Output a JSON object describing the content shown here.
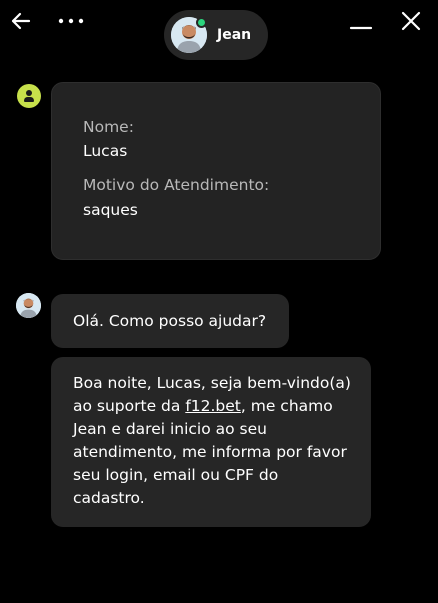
{
  "header": {
    "agent_name": "Jean",
    "icons": {
      "back": "arrow-left-icon",
      "more": "more-horizontal-icon",
      "minimize": "minimize-icon",
      "close": "close-icon"
    },
    "status_color": "#2bd47e"
  },
  "info_card": {
    "name_label": "Nome:",
    "name_value": "Lucas",
    "reason_label": "Motivo do Atendimento:",
    "reason_value": "saques"
  },
  "messages": [
    {
      "sender": "Jean",
      "text": "Olá. Como posso ajudar?"
    },
    {
      "sender": "Jean",
      "lines": [
        "Boa noite, Lucas, seja bem-vindo(a)",
        "ao suporte da ",
        "f12.bet",
        ", me chamo",
        "Jean e darei inicio ao seu",
        "atendimento, me informa por favor",
        "seu login, email ou CPF do",
        "cadastro."
      ]
    }
  ],
  "colors": {
    "background": "#000000",
    "bubble": "#262626",
    "user_avatar": "#c7e04b"
  }
}
